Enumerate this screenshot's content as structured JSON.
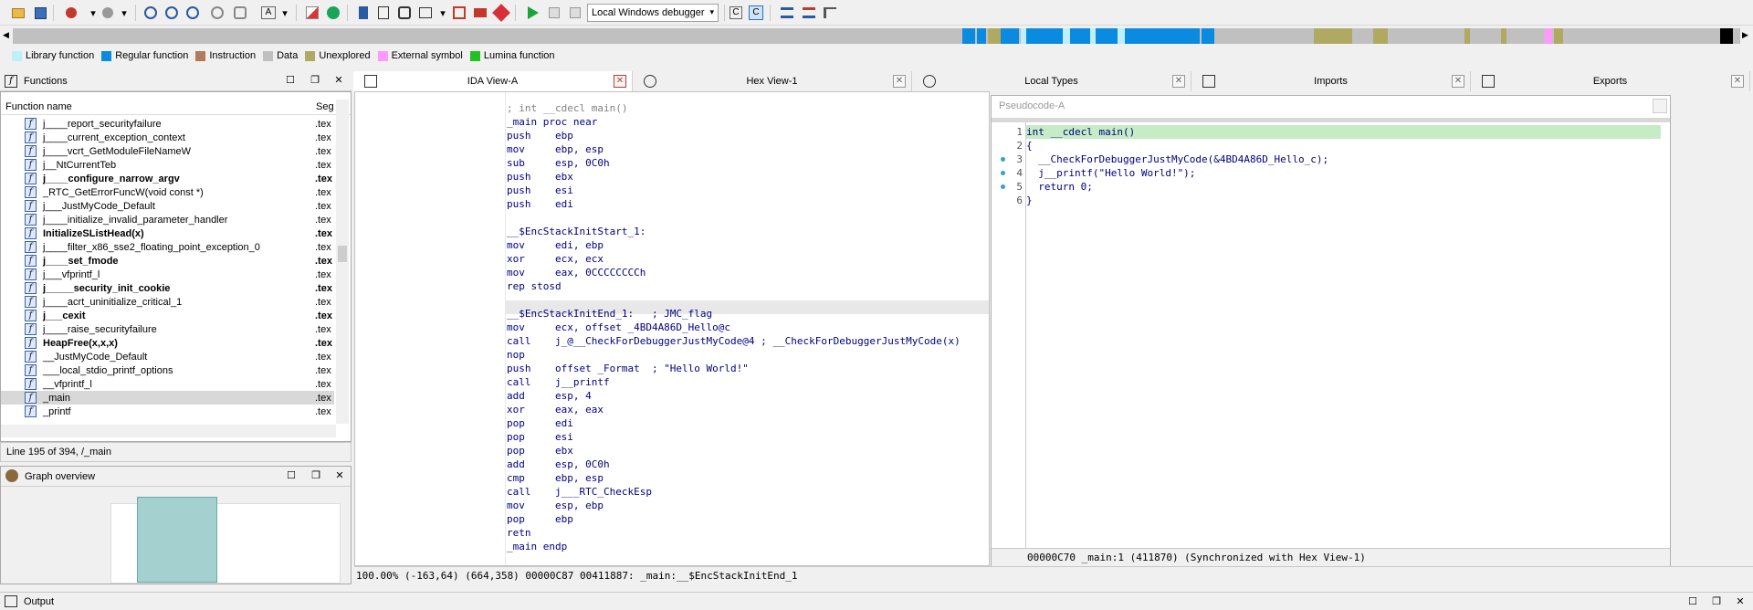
{
  "toolbar": {
    "debugger_select": "Local Windows debugger",
    "icons": [
      "open-icon",
      "save-icon",
      "jump-back-icon",
      "jump-forward-icon",
      "graph-icon",
      "flow-icon",
      "proximity-icon",
      "refresh-icon",
      "text-icon",
      "warning-icon",
      "breakpoint-icon",
      "run-icon",
      "pause-icon",
      "stop-icon",
      "decompile-icon",
      "decompile-active-icon",
      "list-icon"
    ]
  },
  "legend": [
    {
      "label": "Library function",
      "color": "#bdf0fb"
    },
    {
      "label": "Regular function",
      "color": "#0a8be0"
    },
    {
      "label": "Instruction",
      "color": "#b37b5e"
    },
    {
      "label": "Data",
      "color": "#c0c0c0"
    },
    {
      "label": "Unexplored",
      "color": "#b0a962"
    },
    {
      "label": "External symbol",
      "color": "#ff99ff"
    },
    {
      "label": "Lumina function",
      "color": "#22c022"
    }
  ],
  "functions_panel": {
    "title": "Functions",
    "col_name": "Function name",
    "col_seg": "Seg",
    "rows": [
      {
        "name": "j____report_securityfailure",
        "seg": ".tex",
        "bold": false
      },
      {
        "name": "j____current_exception_context",
        "seg": ".tex",
        "bold": false
      },
      {
        "name": "j____vcrt_GetModuleFileNameW",
        "seg": ".tex",
        "bold": false
      },
      {
        "name": "j__NtCurrentTeb",
        "seg": ".tex",
        "bold": false
      },
      {
        "name": "j____configure_narrow_argv",
        "seg": ".tex",
        "bold": true
      },
      {
        "name": "_RTC_GetErrorFuncW(void const *)",
        "seg": ".tex",
        "bold": false
      },
      {
        "name": "j___JustMyCode_Default",
        "seg": ".tex",
        "bold": false
      },
      {
        "name": "j____initialize_invalid_parameter_handler",
        "seg": ".tex",
        "bold": false
      },
      {
        "name": "InitializeSListHead(x)",
        "seg": ".tex",
        "bold": true
      },
      {
        "name": "j____filter_x86_sse2_floating_point_exception_0",
        "seg": ".tex",
        "bold": false
      },
      {
        "name": "j____set_fmode",
        "seg": ".tex",
        "bold": true
      },
      {
        "name": "j___vfprintf_l",
        "seg": ".tex",
        "bold": false
      },
      {
        "name": "j_____security_init_cookie",
        "seg": ".tex",
        "bold": true
      },
      {
        "name": "j____acrt_uninitialize_critical_1",
        "seg": ".tex",
        "bold": false
      },
      {
        "name": "j___cexit",
        "seg": ".tex",
        "bold": true
      },
      {
        "name": "j____raise_securityfailure",
        "seg": ".tex",
        "bold": false
      },
      {
        "name": "HeapFree(x,x,x)",
        "seg": ".tex",
        "bold": true
      },
      {
        "name": "__JustMyCode_Default",
        "seg": ".tex",
        "bold": false
      },
      {
        "name": "___local_stdio_printf_options",
        "seg": ".tex",
        "bold": false
      },
      {
        "name": "__vfprintf_l",
        "seg": ".tex",
        "bold": false
      },
      {
        "name": "_main",
        "seg": ".tex",
        "bold": false
      },
      {
        "name": "_printf",
        "seg": ".tex",
        "bold": false
      }
    ],
    "status": "Line 195 of 394, /_main"
  },
  "graph_overview": {
    "title": "Graph overview"
  },
  "tabs": [
    {
      "label": "IDA View-A",
      "icon": "ida-view-icon"
    },
    {
      "label": "Hex View-1",
      "icon": "hex-view-icon"
    },
    {
      "label": "Local Types",
      "icon": "local-types-icon"
    },
    {
      "label": "Imports",
      "icon": "imports-icon"
    },
    {
      "label": "Exports",
      "icon": "exports-icon"
    }
  ],
  "ida_view": {
    "lines": [
      {
        "a": "; int __cdecl main()",
        "cls": "c"
      },
      {
        "a": "_main proc near",
        "cls": "k"
      },
      {
        "a": "push    ebp",
        "cls": "k"
      },
      {
        "a": "mov     ebp, esp",
        "cls": "k"
      },
      {
        "a": "sub     esp, 0C0h",
        "cls": "k"
      },
      {
        "a": "push    ebx",
        "cls": "k"
      },
      {
        "a": "push    esi",
        "cls": "k"
      },
      {
        "a": "push    edi",
        "cls": "k"
      },
      {
        "a": "",
        "cls": "k"
      },
      {
        "a": "__$EncStackInitStart_1:",
        "cls": "k"
      },
      {
        "a": "mov     edi, ebp",
        "cls": "k"
      },
      {
        "a": "xor     ecx, ecx",
        "cls": "k"
      },
      {
        "a": "mov     eax, 0CCCCCCCCh",
        "cls": "k"
      },
      {
        "a": "rep stosd",
        "cls": "k"
      },
      {
        "a": "",
        "cls": "k"
      },
      {
        "a": "__$EncStackInitEnd_1:   ; JMC_flag",
        "cls": "k"
      },
      {
        "a": "mov     ecx, offset _4BD4A86D_Hello@c",
        "cls": "k"
      },
      {
        "a": "call    j_@__CheckForDebuggerJustMyCode@4 ; __CheckForDebuggerJustMyCode(x)",
        "cls": "k"
      },
      {
        "a": "nop",
        "cls": "k"
      },
      {
        "a": "push    offset _Format  ; \"Hello World!\"",
        "cls": "k"
      },
      {
        "a": "call    j__printf",
        "cls": "k"
      },
      {
        "a": "add     esp, 4",
        "cls": "k"
      },
      {
        "a": "xor     eax, eax",
        "cls": "k"
      },
      {
        "a": "pop     edi",
        "cls": "k"
      },
      {
        "a": "pop     esi",
        "cls": "k"
      },
      {
        "a": "pop     ebx",
        "cls": "k"
      },
      {
        "a": "add     esp, 0C0h",
        "cls": "k"
      },
      {
        "a": "cmp     ebp, esp",
        "cls": "k"
      },
      {
        "a": "call    j___RTC_CheckEsp",
        "cls": "k"
      },
      {
        "a": "mov     esp, ebp",
        "cls": "k"
      },
      {
        "a": "pop     ebp",
        "cls": "k"
      },
      {
        "a": "retn",
        "cls": "k"
      },
      {
        "a": "_main endp",
        "cls": "k"
      }
    ],
    "status": "100.00% (-163,64) (664,358) 00000C87 00411887: _main:__$EncStackInitEnd_1"
  },
  "pseudocode": {
    "title": "Pseudocode-A",
    "lines": [
      {
        "n": "1",
        "code": "int __cdecl main()"
      },
      {
        "n": "2",
        "code": "{"
      },
      {
        "n": "3",
        "code": "  __CheckForDebuggerJustMyCode(&4BD4A86D_Hello_c);"
      },
      {
        "n": "4",
        "code": "  j__printf(\"Hello World!\");"
      },
      {
        "n": "5",
        "code": "  return 0;"
      },
      {
        "n": "6",
        "code": "}"
      }
    ],
    "status": "00000C70 _main:1 (411870) (Synchronized with Hex View-1)"
  },
  "output": {
    "title": "Output"
  }
}
